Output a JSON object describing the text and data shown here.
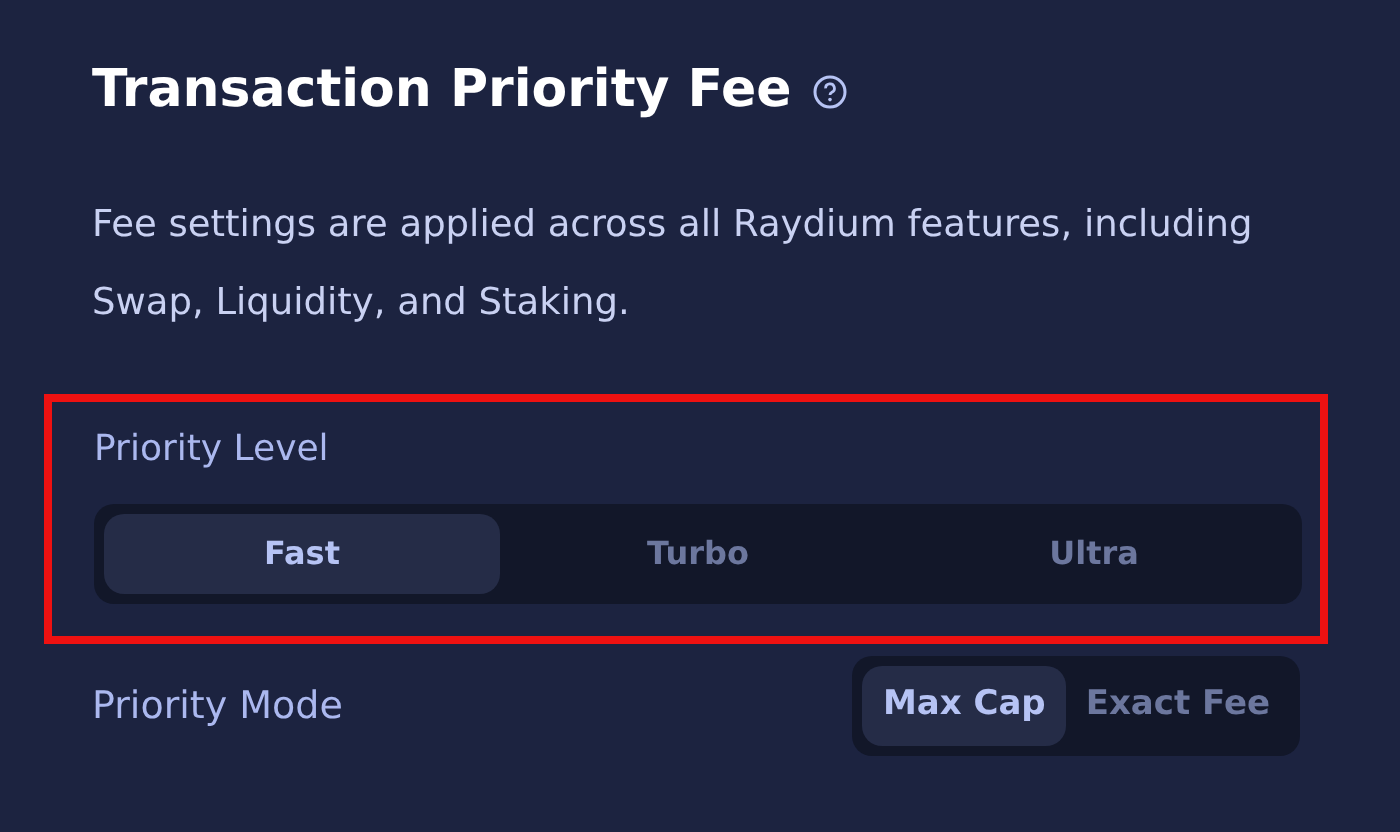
{
  "title": "Transaction Priority Fee",
  "description": "Fee settings are applied across all Raydium features, including Swap, Liquidity, and Staking.",
  "highlight": true,
  "priority_level": {
    "label": "Priority Level",
    "options": [
      {
        "label": "Fast",
        "selected": true
      },
      {
        "label": "Turbo",
        "selected": false
      },
      {
        "label": "Ultra",
        "selected": false
      }
    ]
  },
  "priority_mode": {
    "label": "Priority Mode",
    "options": [
      {
        "label": "Max Cap",
        "selected": true
      },
      {
        "label": "Exact Fee",
        "selected": false
      }
    ]
  }
}
